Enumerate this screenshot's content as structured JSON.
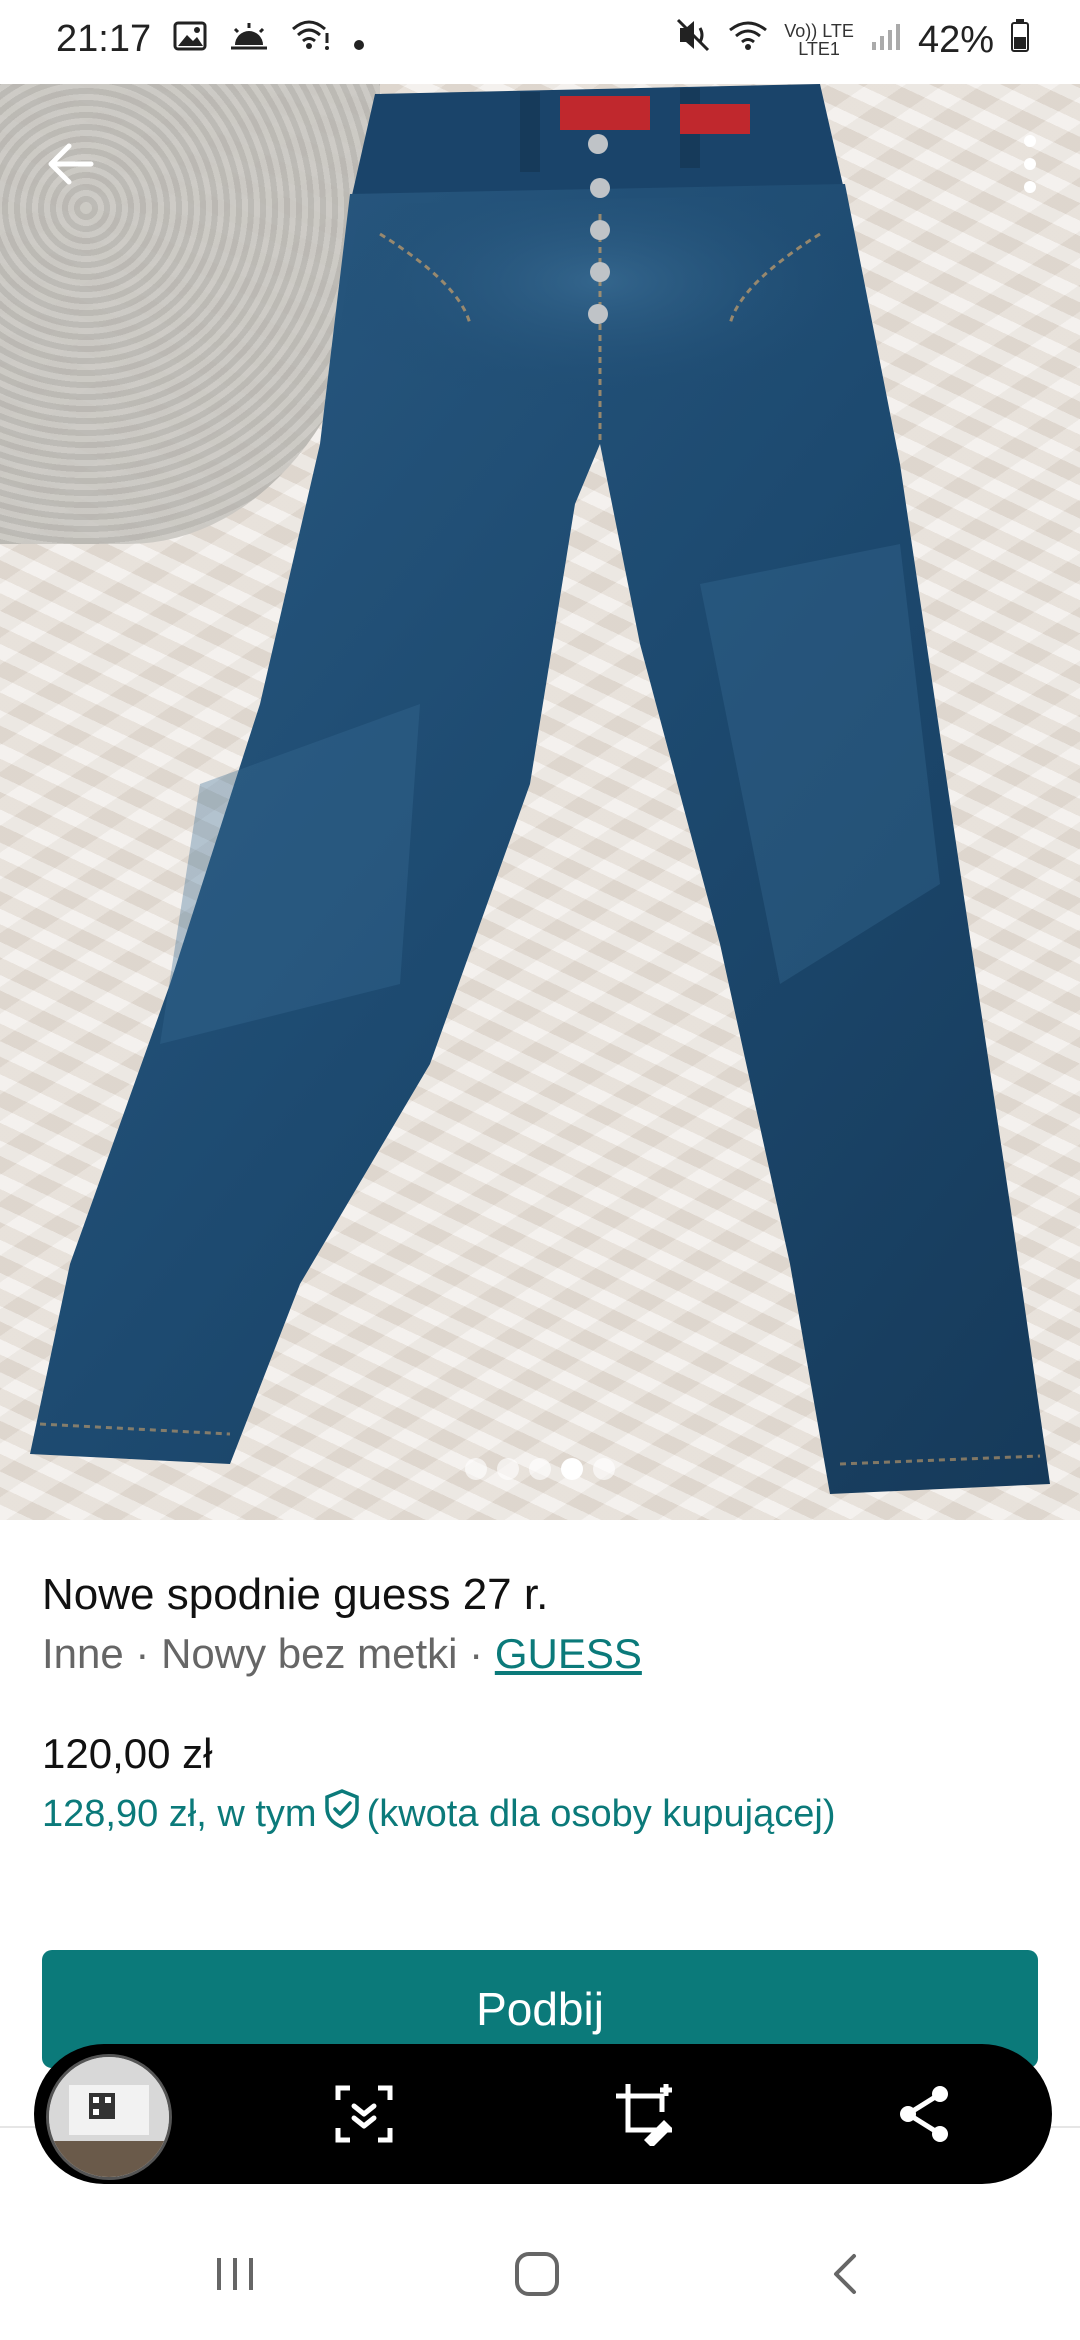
{
  "status_bar": {
    "time": "21:17",
    "battery": "42%",
    "net_top": "Vo)) LTE",
    "net_bottom": "LTE1"
  },
  "listing": {
    "title": "Nowe spodnie guess 27 r.",
    "meta_prefix": "Inne · Nowy bez metki · ",
    "brand": "GUESS",
    "price": "120,00 zł",
    "price_total_prefix": "128,90 zł, w tym",
    "price_total_suffix": "(kwota dla osoby kupującej)",
    "photo_count": 5,
    "active_photo": 4
  },
  "actions": {
    "bump_label": "Podbij"
  },
  "toolbar": {
    "icons": [
      "scroll-capture-icon",
      "crop-edit-icon",
      "share-icon"
    ]
  },
  "nav": {
    "icons": [
      "recents-icon",
      "home-icon",
      "back-icon"
    ]
  },
  "colors": {
    "accent": "#0b7a7a",
    "denim": "#1f4a6e"
  }
}
